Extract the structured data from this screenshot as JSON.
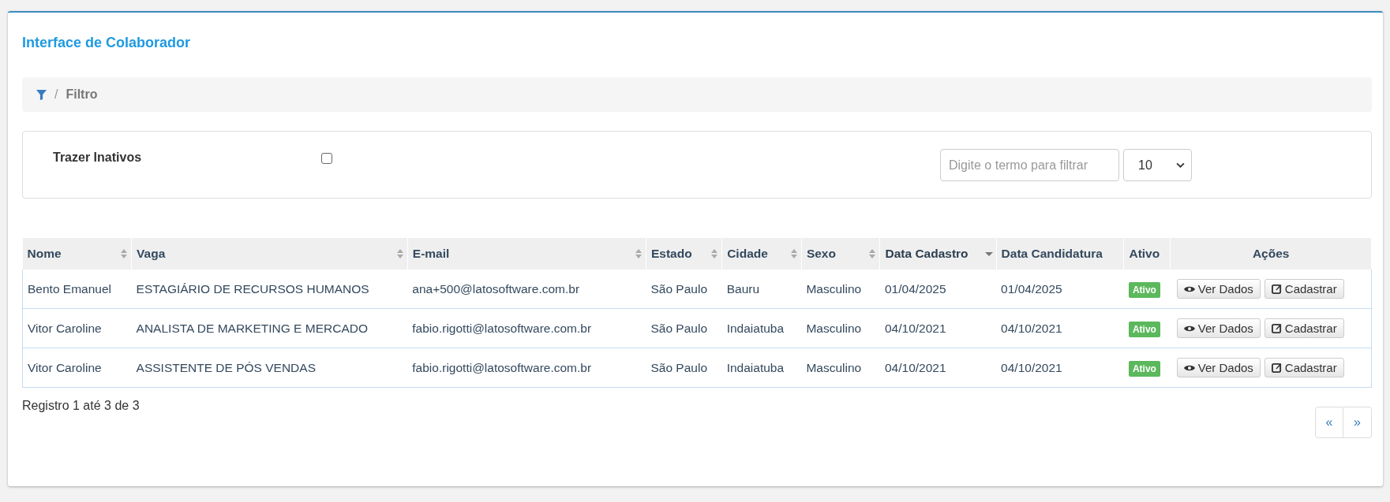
{
  "title": "Interface de Colaborador",
  "breadcrumb": {
    "separator": "/",
    "label": "Filtro"
  },
  "filter": {
    "checkbox_label": "Trazer Inativos",
    "checked": false,
    "search": {
      "placeholder": "Digite o termo para filtrar"
    },
    "page_size": "10"
  },
  "table": {
    "columns": [
      {
        "label": "Nome",
        "sortable": true,
        "sorted_desc": false
      },
      {
        "label": "Vaga",
        "sortable": true,
        "sorted_desc": false
      },
      {
        "label": "E-mail",
        "sortable": true,
        "sorted_desc": false
      },
      {
        "label": "Estado",
        "sortable": true,
        "sorted_desc": false
      },
      {
        "label": "Cidade",
        "sortable": true,
        "sorted_desc": false
      },
      {
        "label": "Sexo",
        "sortable": true,
        "sorted_desc": false
      },
      {
        "label": "Data Cadastro",
        "sortable": true,
        "sorted_desc": true
      },
      {
        "label": "Data Candidatura",
        "sortable": false
      },
      {
        "label": "Ativo",
        "sortable": false
      },
      {
        "label": "Ações",
        "sortable": false
      }
    ],
    "rows": [
      {
        "cells": [
          "Bento Emanuel",
          "ESTAGIÁRIO DE RECURSOS HUMANOS",
          "ana+500@latosoftware.com.br",
          "São Paulo",
          "Bauru",
          "Masculino",
          "01/04/2025",
          "01/04/2025"
        ],
        "status": "Ativo",
        "active": true,
        "actions": [
          "Ver Dados",
          "Cadastrar"
        ]
      },
      {
        "cells": [
          "Vitor Caroline",
          "ANALISTA DE MARKETING E MERCADO",
          "fabio.rigotti@latosoftware.com.br",
          "São Paulo",
          "Indaiatuba",
          "Masculino",
          "04/10/2021",
          "04/10/2021"
        ],
        "status": "Ativo",
        "active": true,
        "actions": [
          "Ver Dados",
          "Cadastrar"
        ]
      },
      {
        "cells": [
          "Vitor Caroline",
          "ASSISTENTE DE PÓS VENDAS",
          "fabio.rigotti@latosoftware.com.br",
          "São Paulo",
          "Indaiatuba",
          "Masculino",
          "04/10/2021",
          "04/10/2021"
        ],
        "status": "Ativo",
        "active": true,
        "actions": [
          "Ver Dados",
          "Cadastrar"
        ]
      }
    ]
  },
  "footer": {
    "summary": "Registro 1 até 3 de 3",
    "pagination": [
      "«",
      "»"
    ]
  }
}
